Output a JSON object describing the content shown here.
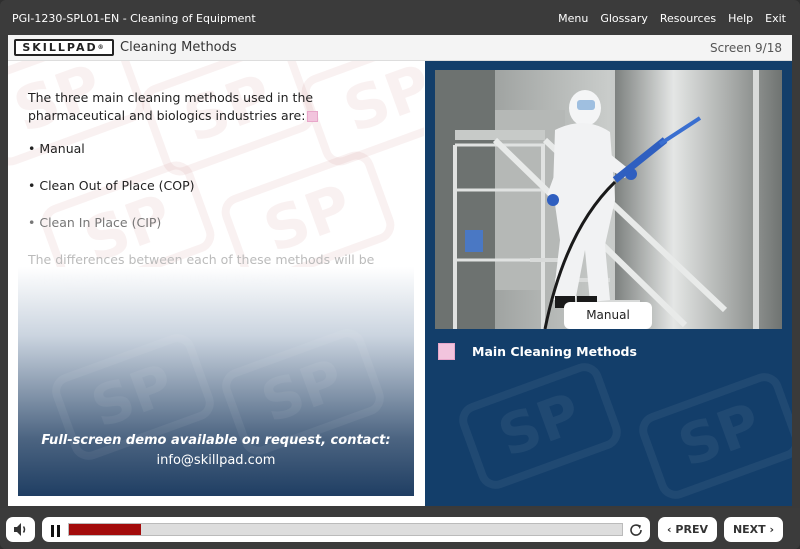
{
  "topbar": {
    "course_title": "PGI-1230-SPL01-EN - Cleaning of Equipment",
    "menu": [
      "Menu",
      "Glossary",
      "Resources",
      "Help",
      "Exit"
    ]
  },
  "header": {
    "logo_text": "SKILLPAD",
    "logo_reg": "®",
    "page_title": "Cleaning Methods",
    "screen_counter": "Screen 9/18"
  },
  "content": {
    "intro": "The three main cleaning methods used in the pharmaceutical and biologics industries are:",
    "bullets": [
      "• Manual",
      "• Clean Out of Place (COP)",
      "• Clean In Place (CIP)"
    ],
    "difference_text": "The differences between each of these methods will be explained over the next number of screens.",
    "demo_note": "Full-screen demo available on request, contact:",
    "demo_email": "info@skillpad.com"
  },
  "right_panel": {
    "photo_caption": "Manual",
    "accordion_label": "Main Cleaning Methods"
  },
  "player": {
    "prev_label": "PREV",
    "next_label": "NEXT",
    "progress": 0.13
  },
  "colors": {
    "topbar": "#3b3b3b",
    "panel_blue": "#133e6a",
    "progress": "#a30b0b",
    "accent_pink": "#f2c4dd"
  },
  "icons": {
    "volume": "speaker-icon",
    "pause": "pause-icon",
    "replay": "replay-icon",
    "prev": "chevron-left-icon",
    "next": "chevron-right-icon"
  }
}
